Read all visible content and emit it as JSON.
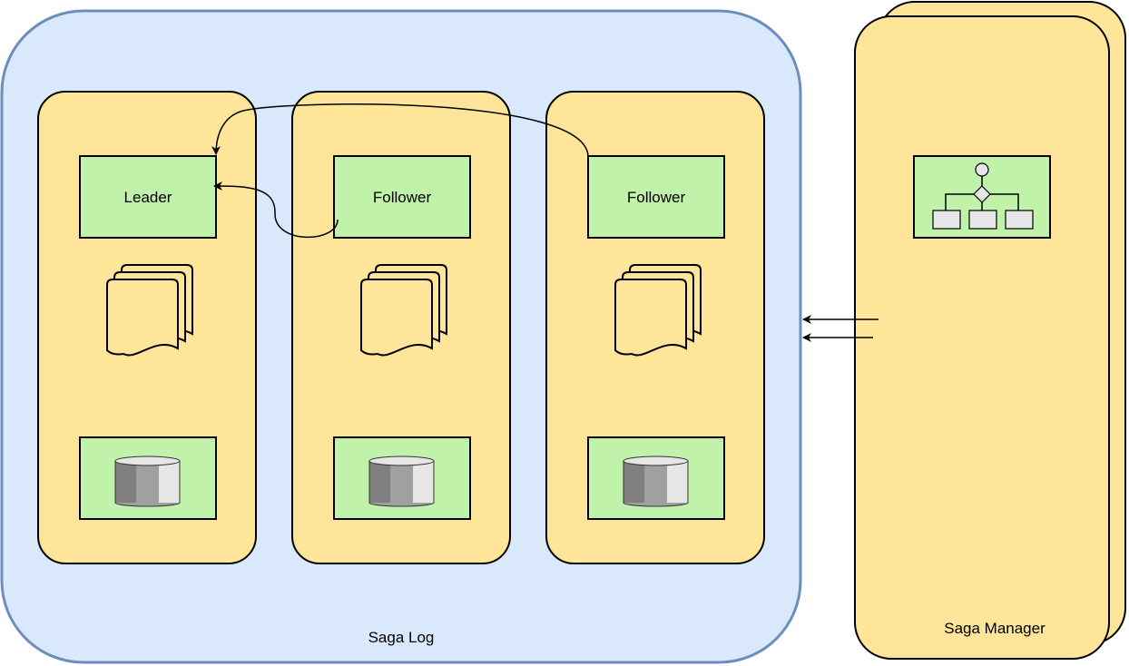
{
  "saga_log": {
    "label": "Saga Log",
    "nodes": [
      {
        "label": "Leader"
      },
      {
        "label": "Follower"
      },
      {
        "label": "Follower"
      }
    ]
  },
  "saga_manager": {
    "label": "Saga Manager"
  },
  "colors": {
    "saga_log_fill": "#dae8fc",
    "saga_log_stroke": "#6c8ebf",
    "node_fill": "#ffe599",
    "box_fill": "#c0f2aa"
  }
}
